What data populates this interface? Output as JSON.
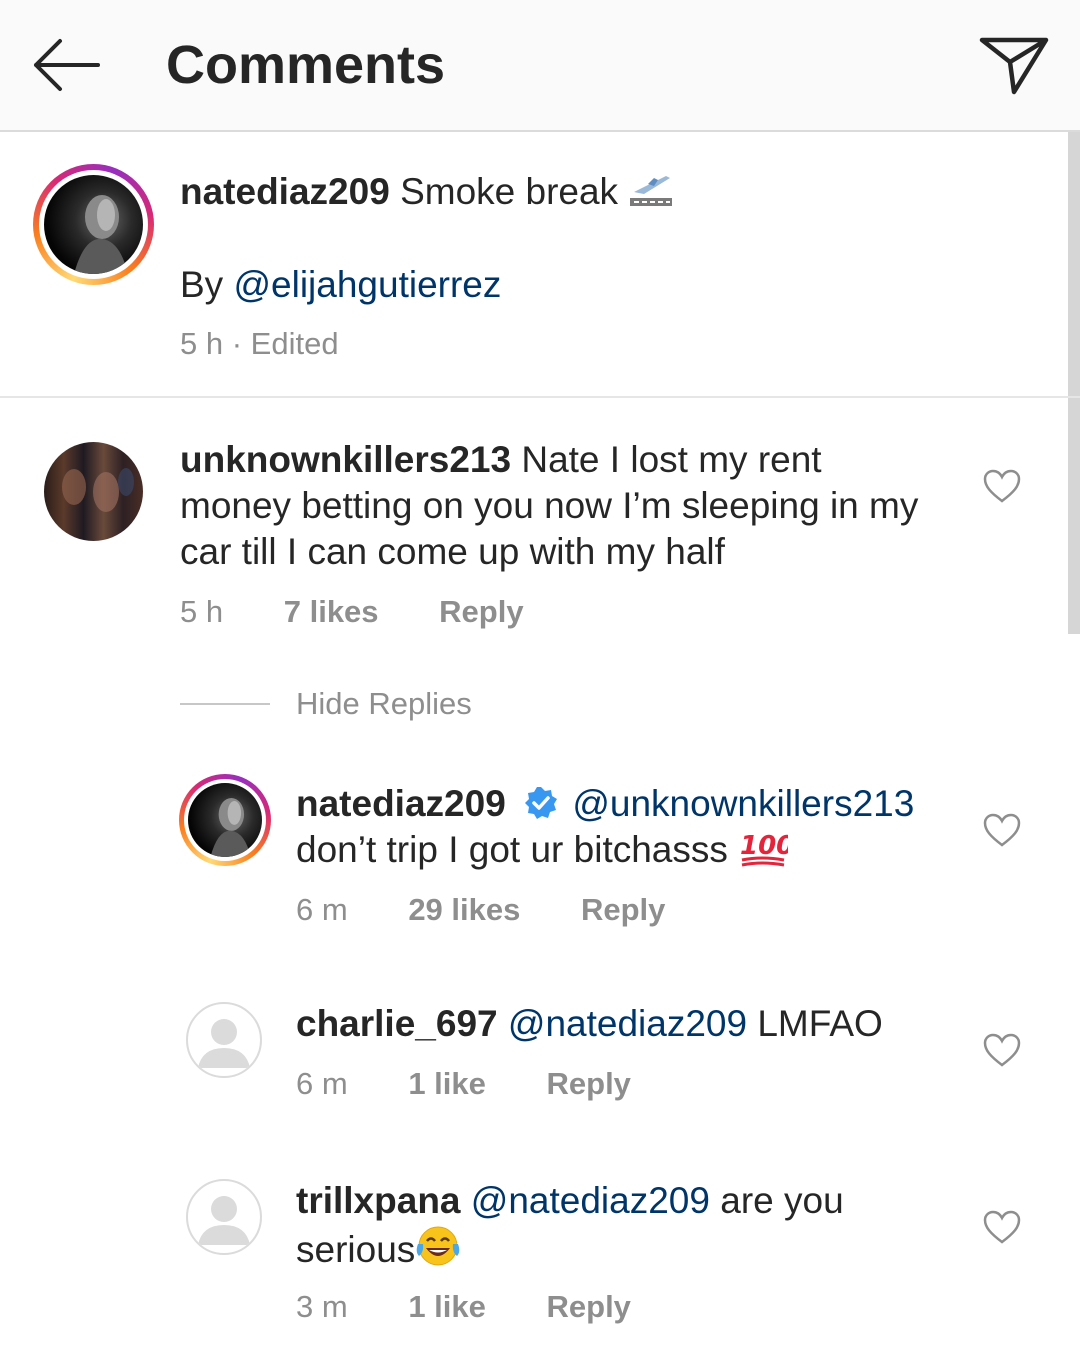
{
  "header": {
    "title": "Comments",
    "back_icon": "arrow-left-icon",
    "send_icon": "paper-plane-icon"
  },
  "caption": {
    "username": "natediaz209",
    "text": "Smoke break",
    "emoji": "airplane-departure-emoji",
    "by_prefix": "By",
    "by_mention": "@elijahgutierrez",
    "time": "5 h",
    "edited": "· Edited"
  },
  "comment": {
    "username": "unknownkillers213",
    "text": "Nate I lost my rent money betting on you now I’m sleeping in my car till I can come up with my half",
    "time": "5 h",
    "likes": "7 likes",
    "reply_label": "Reply"
  },
  "hide_replies_label": "Hide Replies",
  "replies": [
    {
      "username": "natediaz209",
      "verified": true,
      "mention": "@unknownkillers213",
      "text": "don’t trip I got ur bitchasss",
      "emoji": "hundred-points-emoji",
      "time": "6 m",
      "likes": "29 likes",
      "reply_label": "Reply"
    },
    {
      "username": "charlie_697",
      "mention": "@natediaz209",
      "text": "LMFAO",
      "time": "6 m",
      "likes": "1 like",
      "reply_label": "Reply"
    },
    {
      "username": "trillxpana",
      "mention": "@natediaz209",
      "text": "are you serious",
      "emoji": "tears-of-joy-emoji",
      "time": "3 m",
      "likes": "1 like",
      "reply_label": "Reply"
    }
  ],
  "colors": {
    "mention": "#003569",
    "meta_gray": "#8e8e8e",
    "verified_blue": "#3897f0",
    "header_bg": "#fafafa"
  }
}
